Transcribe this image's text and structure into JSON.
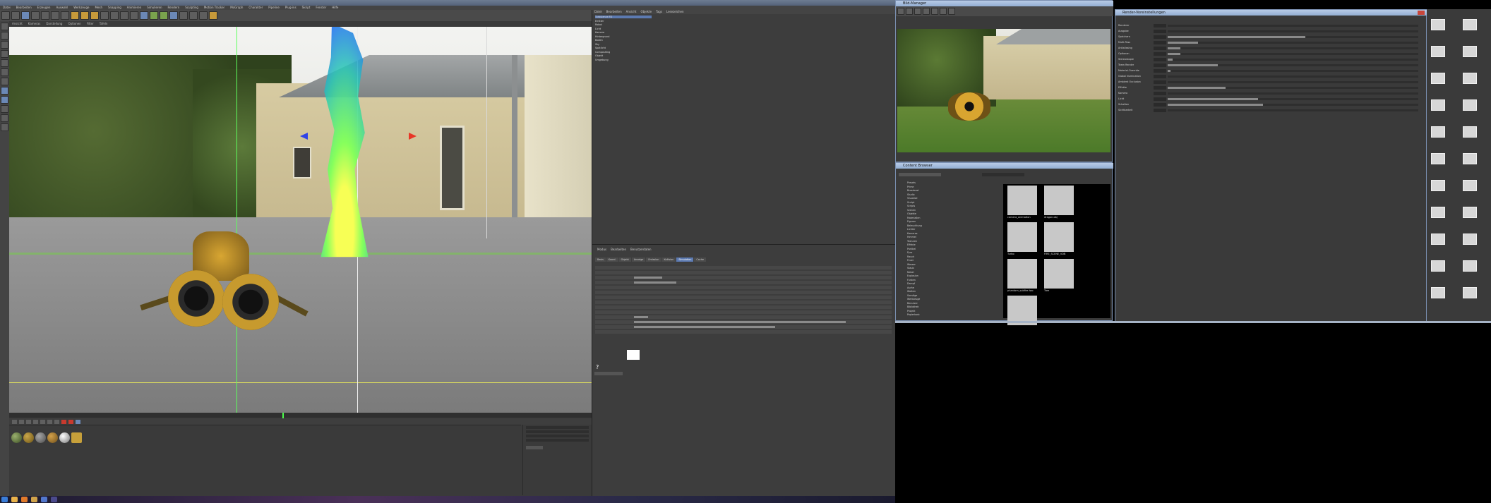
{
  "c4d": {
    "title": "",
    "menu": [
      "Datei",
      "Bearbeiten",
      "Erzeugen",
      "Auswahl",
      "Werkzeuge",
      "Mesh",
      "Snapping",
      "Animieren",
      "Simulieren",
      "Rendern",
      "Sculpting",
      "Motion Tracker",
      "MoGraph",
      "Charakter",
      "Pipeline",
      "Plug-ins",
      "Skript",
      "Fenster",
      "Hilfe"
    ],
    "viewport_menu": [
      "Ansicht",
      "Kameras",
      "Darstellung",
      "Optionen",
      "Filter",
      "Tafeln"
    ],
    "object_manager_menu": [
      "Datei",
      "Bearbeiten",
      "Ansicht",
      "Objekte",
      "Tags",
      "Lesezeichen"
    ],
    "attr_menu": [
      "Modus",
      "Bearbeiten",
      "Benutzerdaten"
    ],
    "attr_tabs": [
      "Basis",
      "Koord.",
      "Objekt",
      "Anzeige",
      "Emission",
      "Kollision",
      "Simulation",
      "Cache"
    ],
    "attr_help": "?",
    "objects": [
      {
        "label": "Turbulence FD",
        "selected": true
      },
      {
        "label": "Emitter",
        "selected": false
      },
      {
        "label": "Robot",
        "selected": false
      },
      {
        "label": "Licht",
        "selected": false
      },
      {
        "label": "Kamera",
        "selected": false
      },
      {
        "label": "Hintergrund",
        "selected": false
      },
      {
        "label": "Boden",
        "selected": false
      },
      {
        "label": "Sky",
        "selected": false
      },
      {
        "label": "Spotlicht",
        "selected": false
      },
      {
        "label": "Compositing",
        "selected": false
      },
      {
        "label": "Objekt",
        "selected": false
      },
      {
        "label": "Umgebung",
        "selected": false
      }
    ]
  },
  "picture_viewer": {
    "title": "Bild-Manager",
    "menu": [
      "Datei",
      "Bearbeiten",
      "Ansicht",
      "Vergleichen",
      "Animation"
    ],
    "status": ""
  },
  "content_browser": {
    "title": "Content Browser",
    "tree": [
      "Presets",
      "Prime",
      "Broadcast",
      "Studio",
      "Visualize",
      "Sculpt",
      "Scripts",
      "Szenen",
      "Objekte",
      "Materialien",
      "Figuren",
      "Beleuchtung",
      "Lichter",
      "Kameras",
      "Himmel",
      "Texturen",
      "Effekte",
      "Partikel",
      "Pyro",
      "Rauch",
      "Feuer",
      "Wasser",
      "Staub",
      "Nebel",
      "Explosion",
      "Funken",
      "Dampf",
      "Asche",
      "Wolken",
      "Sonstige",
      "Werkzeuge",
      "Benutzer",
      "Bibliothek",
      "Projekt",
      "Papierkorb"
    ],
    "thumbs": [
      {
        "label": "camera_animation"
      },
      {
        "label": "dragon.obj"
      },
      {
        "label": "Turbo"
      },
      {
        "label": "FIRE_SCENE_VDB"
      },
      {
        "label": "phantom_subfire.lwo"
      },
      {
        "label": "Tree"
      },
      {
        "label": ""
      }
    ]
  },
  "render_settings": {
    "title": "Render-Voreinstellungen",
    "rows": [
      {
        "label": "Renderer",
        "fill": 0.0
      },
      {
        "label": "Ausgabe",
        "fill": 0.0
      },
      {
        "label": "Speichern",
        "fill": 0.55
      },
      {
        "label": "Multi-Pass",
        "fill": 0.12
      },
      {
        "label": "Antialiasing",
        "fill": 0.05
      },
      {
        "label": "Optionen",
        "fill": 0.05
      },
      {
        "label": "Stereoskopie",
        "fill": 0.02
      },
      {
        "label": "Team Render",
        "fill": 0.2
      },
      {
        "label": "Material-Override",
        "fill": 0.01
      },
      {
        "label": "Global Illumination",
        "fill": 0.0
      },
      {
        "label": "Ambient Occlusion",
        "fill": 0.0
      },
      {
        "label": "Effekte",
        "fill": 0.23
      },
      {
        "label": "Kamera",
        "fill": 0.0
      },
      {
        "label": "Licht",
        "fill": 0.36
      },
      {
        "label": "Schatten",
        "fill": 0.38
      },
      {
        "label": "Sichtbarkeit",
        "fill": 0.0
      }
    ]
  },
  "icon_grid": {
    "labels": [
      "",
      "",
      "",
      "",
      "",
      "",
      "",
      "",
      "",
      "",
      "",
      "",
      "",
      "",
      "",
      "",
      "",
      "",
      "",
      "",
      "",
      ""
    ]
  }
}
